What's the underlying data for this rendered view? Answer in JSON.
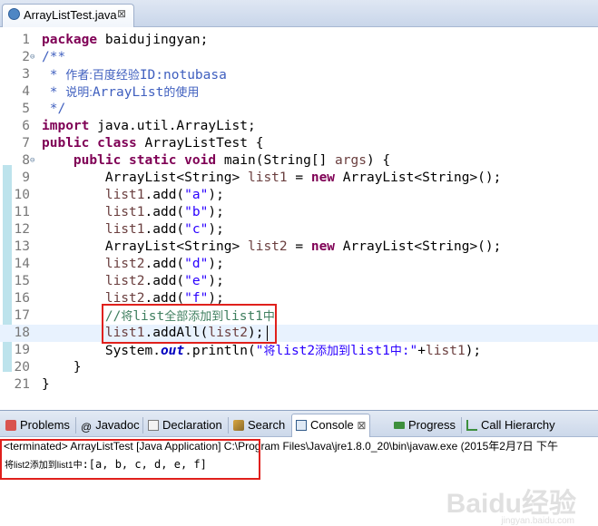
{
  "editor_tab": {
    "title": "ArrayListTest.java",
    "close": "⊠"
  },
  "code_lines": [
    {
      "n": "1",
      "t": "package baidujingyan;"
    },
    {
      "n": "2",
      "t": "/**"
    },
    {
      "n": "3",
      "t": " * 作者:百度经验ID:notubasa"
    },
    {
      "n": "4",
      "t": " * 说明:ArrayList的使用"
    },
    {
      "n": "5",
      "t": " */"
    },
    {
      "n": "6",
      "t": "import java.util.ArrayList;"
    },
    {
      "n": "7",
      "t": "public class ArrayListTest {"
    },
    {
      "n": "8",
      "t": "    public static void main(String[] args) {"
    },
    {
      "n": "9",
      "t": "        ArrayList<String> list1 = new ArrayList<String>();"
    },
    {
      "n": "10",
      "t": "        list1.add(\"a\");"
    },
    {
      "n": "11",
      "t": "        list1.add(\"b\");"
    },
    {
      "n": "12",
      "t": "        list1.add(\"c\");"
    },
    {
      "n": "13",
      "t": "        ArrayList<String> list2 = new ArrayList<String>();"
    },
    {
      "n": "14",
      "t": "        list2.add(\"d\");"
    },
    {
      "n": "15",
      "t": "        list2.add(\"e\");"
    },
    {
      "n": "16",
      "t": "        list2.add(\"f\");"
    },
    {
      "n": "17",
      "t": "        //将list全部添加到list1中"
    },
    {
      "n": "18",
      "t": "        list1.addAll(list2);"
    },
    {
      "n": "19",
      "t": "        System.out.println(\"将list2添加到list1中:\"+list1);"
    },
    {
      "n": "20",
      "t": "    }"
    },
    {
      "n": "21",
      "t": "}"
    }
  ],
  "fold_glyph": "⊖",
  "view_tabs": {
    "problems": "Problems",
    "javadoc": "Javadoc",
    "declaration": "Declaration",
    "search": "Search",
    "console": "Console",
    "console_close": "⊠",
    "progress": "Progress",
    "call_hierarchy": "Call Hierarchy"
  },
  "console": {
    "header": "<terminated> ArrayListTest [Java Application] C:\\Program Files\\Java\\jre1.8.0_20\\bin\\javaw.exe (2015年2月7日 下午",
    "output_prefix": "将list2添加到list1中",
    "output_rest": ":[a, b, c, d, e, f]"
  },
  "watermark": {
    "logo": "Baidu经验",
    "url": "jingyan.baidu.com"
  },
  "colors": {
    "keyword": "#7f0055",
    "string": "#2a00ff",
    "comment": "#3f7f5f",
    "javadoc": "#3f5fbf",
    "highlight": "#e0201c"
  }
}
